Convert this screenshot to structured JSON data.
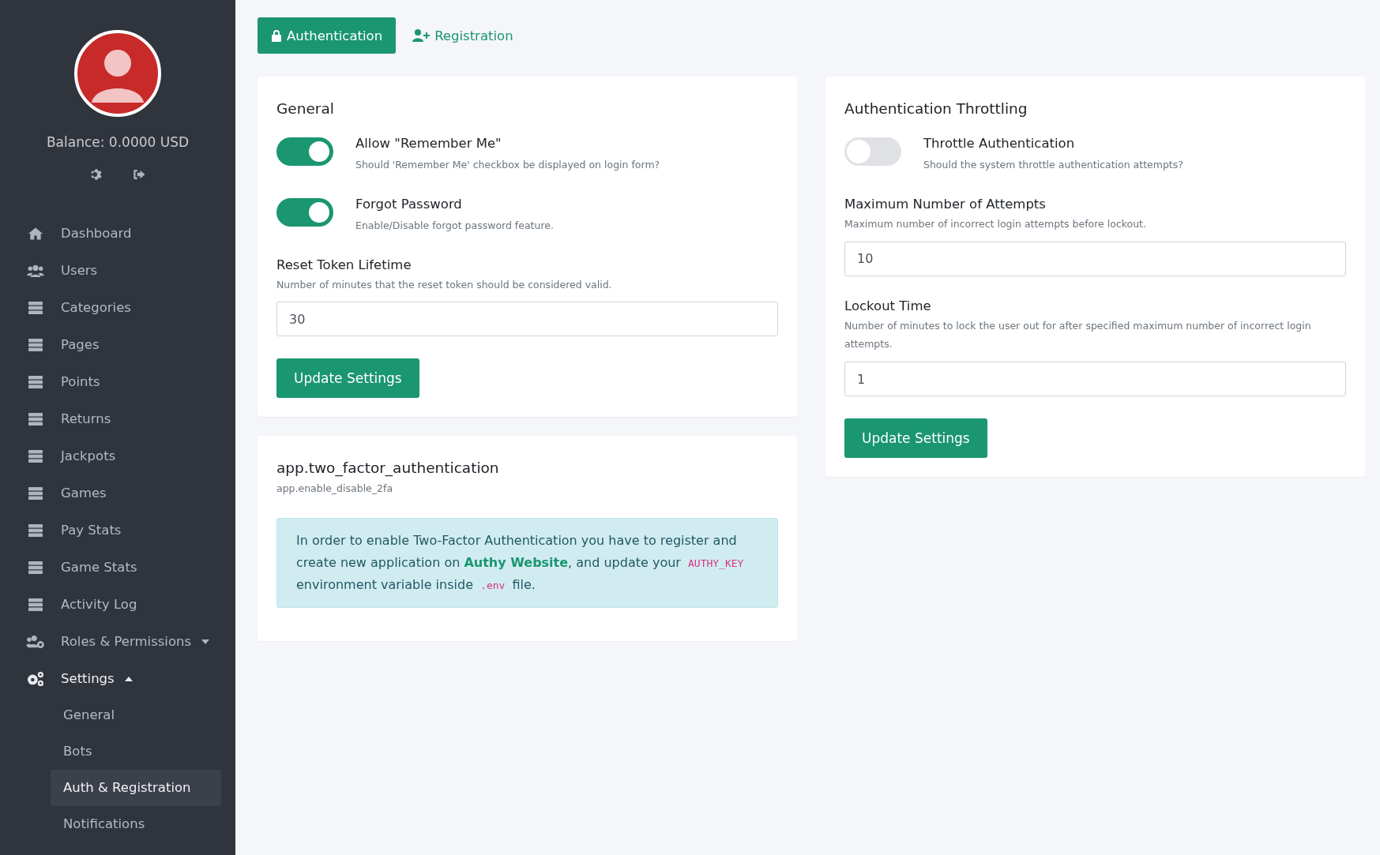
{
  "sidebar": {
    "balance": "Balance: 0.0000 USD",
    "items": [
      {
        "label": "Dashboard",
        "kind": "home"
      },
      {
        "label": "Users",
        "kind": "users"
      },
      {
        "label": "Categories",
        "kind": "list"
      },
      {
        "label": "Pages",
        "kind": "list"
      },
      {
        "label": "Points",
        "kind": "list"
      },
      {
        "label": "Returns",
        "kind": "list"
      },
      {
        "label": "Jackpots",
        "kind": "list"
      },
      {
        "label": "Games",
        "kind": "list"
      },
      {
        "label": "Pay Stats",
        "kind": "list"
      },
      {
        "label": "Game Stats",
        "kind": "list"
      },
      {
        "label": "Activity Log",
        "kind": "list"
      },
      {
        "label": "Roles & Permissions",
        "kind": "roles",
        "expanded": false
      },
      {
        "label": "Settings",
        "kind": "settings",
        "expanded": true,
        "children": [
          {
            "label": "General",
            "selected": false
          },
          {
            "label": "Bots",
            "selected": false
          },
          {
            "label": "Auth & Registration",
            "selected": true
          },
          {
            "label": "Notifications",
            "selected": false
          }
        ]
      }
    ]
  },
  "tabs": [
    {
      "label": "Authentication",
      "kind": "lock",
      "selected": true
    },
    {
      "label": "Registration",
      "kind": "add-user",
      "selected": false
    }
  ],
  "general": {
    "title": "General",
    "toggles": [
      {
        "label": "Allow \"Remember Me\"",
        "hint": "Should 'Remember Me' checkbox be displayed on login form?",
        "on": true
      },
      {
        "label": "Forgot Password",
        "hint": "Enable/Disable forgot password feature.",
        "on": true
      }
    ],
    "fields": [
      {
        "label": "Reset Token Lifetime",
        "hint": "Number of minutes that the reset token should be considered valid.",
        "value": "30"
      }
    ],
    "button": "Update Settings"
  },
  "two_factor": {
    "title": "app.two_factor_authentication",
    "subtitle": "app.enable_disable_2fa",
    "alert": [
      {
        "kind": "text",
        "text": "In order to enable Two-Factor Authentication you have to register and create new application on "
      },
      {
        "kind": "link",
        "text": "Authy Website"
      },
      {
        "kind": "text",
        "text": ", and update your "
      },
      {
        "kind": "code",
        "text": "AUTHY_KEY"
      },
      {
        "kind": "text",
        "text": " environment variable inside "
      },
      {
        "kind": "code",
        "text": ".env"
      },
      {
        "kind": "text",
        "text": " file."
      }
    ]
  },
  "throttling": {
    "title": "Authentication Throttling",
    "toggles": [
      {
        "label": "Throttle Authentication",
        "hint": "Should the system throttle authentication attempts?",
        "on": false
      }
    ],
    "fields": [
      {
        "label": "Maximum Number of Attempts",
        "hint": "Maximum number of incorrect login attempts before lockout.",
        "value": "10"
      },
      {
        "label": "Lockout Time",
        "hint": "Number of minutes to lock the user out for after specified maximum number of incorrect login attempts.",
        "value": "1"
      }
    ],
    "button": "Update Settings"
  }
}
